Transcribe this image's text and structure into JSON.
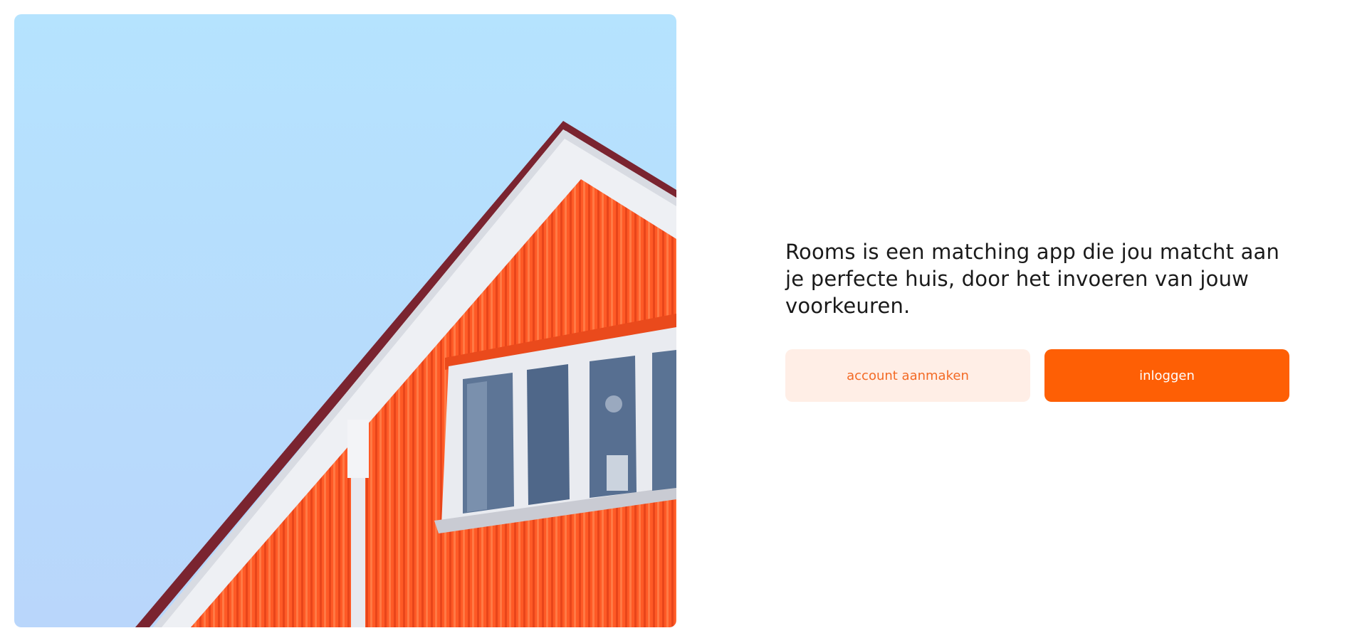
{
  "hero": {
    "image_name": "orange-house-gable-photo",
    "colors": {
      "sky_top": "#b5e3fe",
      "sky_bottom": "#b9d6fb",
      "siding": "#ff5a26",
      "trim": "#eef0f4",
      "roof_edge": "#7a2430",
      "window_glass": "#5d7596"
    }
  },
  "intro": {
    "tagline": "Rooms is een matching app die jou matcht aan je perfecte huis, door het invoeren van jouw voorkeuren."
  },
  "actions": {
    "create_account_label": "account aanmaken",
    "login_label": "inloggen"
  },
  "theme": {
    "accent": "#fe5f05",
    "accent_soft": "#ffeee6",
    "accent_text": "#f36a25",
    "text": "#1a1a1a",
    "background": "#ffffff"
  }
}
